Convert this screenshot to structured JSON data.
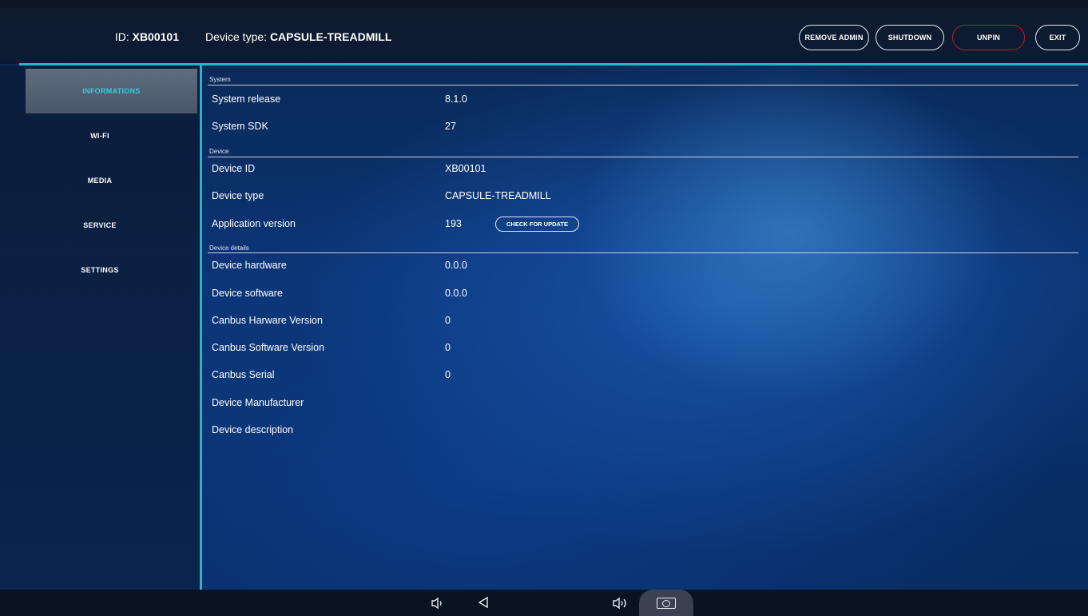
{
  "header": {
    "id_label": "ID:",
    "id_value": "XB00101",
    "type_label": "Device type:",
    "type_value": "CAPSULE-TREADMILL",
    "buttons": {
      "remove_admin": "REMOVE ADMIN",
      "shutdown": "SHUTDOWN",
      "unpin": "UNPIN",
      "exit": "EXIT"
    }
  },
  "sidebar": {
    "items": [
      {
        "label": "INFORMATIONS",
        "active": true
      },
      {
        "label": "WI-FI"
      },
      {
        "label": "MEDIA"
      },
      {
        "label": "SERVICE"
      },
      {
        "label": "SETTINGS"
      }
    ]
  },
  "sections": {
    "system": {
      "title": "System",
      "rows": [
        {
          "label": "System release",
          "value": "8.1.0"
        },
        {
          "label": "System SDK",
          "value": "27"
        }
      ]
    },
    "device": {
      "title": "Device",
      "rows": [
        {
          "label": "Device ID",
          "value": "XB00101"
        },
        {
          "label": "Device type",
          "value": "CAPSULE-TREADMILL"
        },
        {
          "label": "Application version",
          "value": "193"
        }
      ],
      "update_button": "CHECK FOR UPDATE"
    },
    "details": {
      "title": "Device details",
      "rows": [
        {
          "label": "Device hardware",
          "value": "0.0.0"
        },
        {
          "label": "Device software",
          "value": "0.0.0"
        },
        {
          "label": "Canbus Harware Version",
          "value": "0"
        },
        {
          "label": "Canbus Software Version",
          "value": "0"
        },
        {
          "label": "Canbus Serial",
          "value": "0"
        },
        {
          "label": "Device Manufacturer",
          "value": ""
        },
        {
          "label": "Device description",
          "value": ""
        }
      ]
    }
  },
  "navbar": {
    "icons": [
      "volume-down-icon",
      "back-icon",
      "volume-up-icon",
      "screenshot-icon"
    ]
  },
  "colors": {
    "accent": "#25b7c8",
    "active_text": "#2fd0e0",
    "danger": "#b41f2a"
  }
}
